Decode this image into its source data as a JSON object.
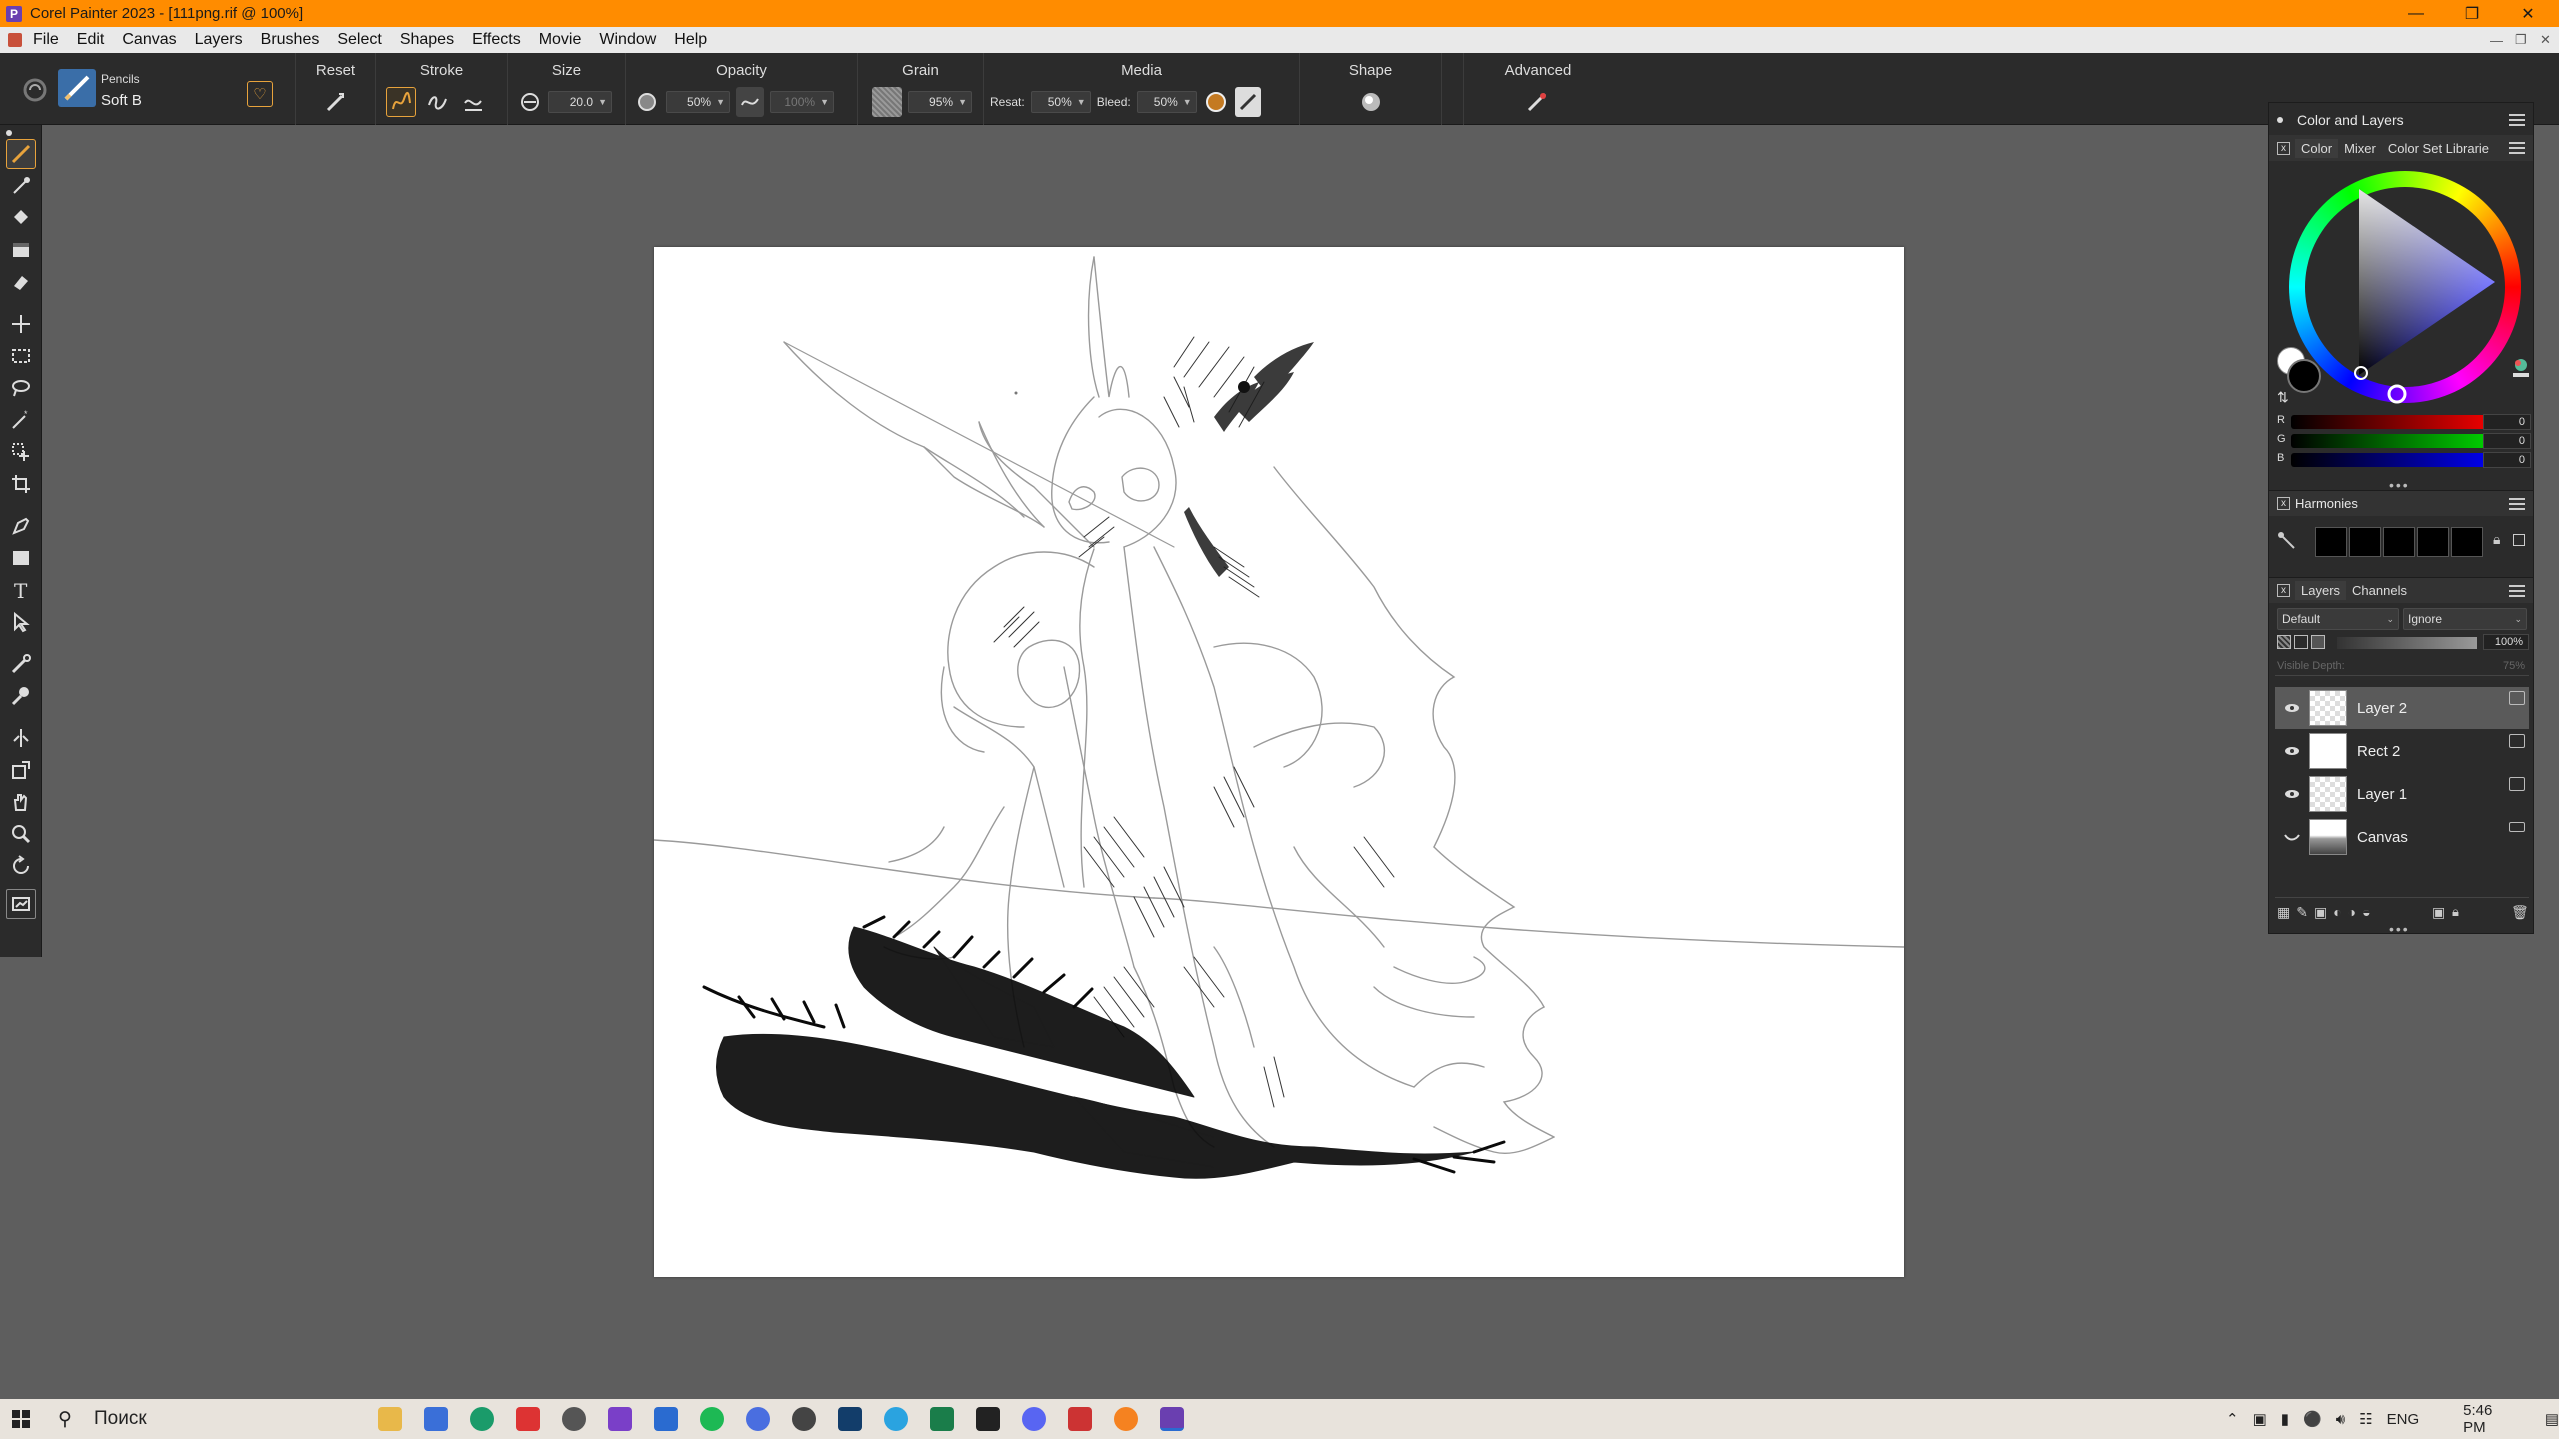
{
  "window": {
    "title": "Corel Painter 2023 - [111png.rif @ 100%]",
    "app_icon_letter": "P"
  },
  "menu": [
    "File",
    "Edit",
    "Canvas",
    "Layers",
    "Brushes",
    "Select",
    "Shapes",
    "Effects",
    "Movie",
    "Window",
    "Help"
  ],
  "brush": {
    "category": "Pencils",
    "variant": "Soft B"
  },
  "props": {
    "reset_label": "Reset",
    "stroke_label": "Stroke",
    "size_label": "Size",
    "size_value": "20.0",
    "opacity_label": "Opacity",
    "opacity_value": "50%",
    "opacity_expr_value": "100%",
    "grain_label": "Grain",
    "grain_value": "95%",
    "media_label": "Media",
    "resat_label": "Resat:",
    "resat_value": "50%",
    "bleed_label": "Bleed:",
    "bleed_value": "50%",
    "shape_label": "Shape",
    "advanced_label": "Advanced"
  },
  "panel": {
    "title": "Color and Layers",
    "color_tabs": [
      "Color",
      "Mixer",
      "Color Set Librarie"
    ],
    "rgb": [
      {
        "label": "R",
        "value": "0"
      },
      {
        "label": "G",
        "value": "0"
      },
      {
        "label": "B",
        "value": "0"
      }
    ],
    "harmonies_title": "Harmonies",
    "layer_tabs": [
      "Layers",
      "Channels"
    ],
    "composite_method": "Default",
    "composite_depth": "Ignore",
    "opacity_value": "100%",
    "visible_depth_label": "Visible Depth:",
    "visible_depth_value": "75%",
    "layers": [
      {
        "name": "Layer 2",
        "selected": true
      },
      {
        "name": "Rect 2",
        "selected": false
      },
      {
        "name": "Layer 1",
        "selected": false
      },
      {
        "name": "Canvas",
        "selected": false
      }
    ]
  },
  "taskbar": {
    "search_placeholder": "Поиск",
    "lang": "ENG",
    "time": "5:46 PM"
  },
  "colors": {
    "accent": "#ff8c00",
    "ui_bg": "#2b2b2b",
    "workspace": "#5e5e5e",
    "selection": "#e8a33c"
  }
}
